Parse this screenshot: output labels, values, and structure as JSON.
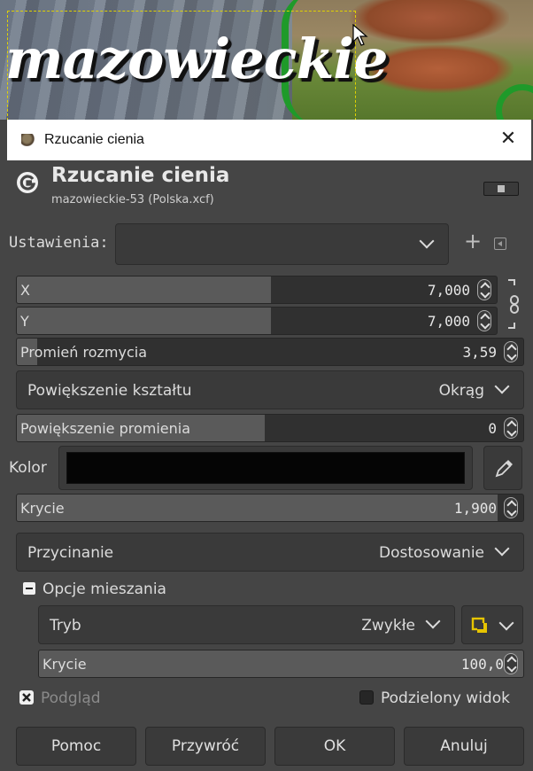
{
  "canvas": {
    "image_title_text": "mazowieckie"
  },
  "window": {
    "title": "Rzucanie cienia",
    "close_glyph": "✕"
  },
  "header": {
    "title": "Rzucanie cienia",
    "subtitle": "mazowieckie-53 (Polska.xcf)"
  },
  "presets": {
    "label": "Ustawienia:",
    "value": "",
    "add_glyph": "+"
  },
  "fields": {
    "x": {
      "label": "X",
      "value": "7,000",
      "fill": 0.53
    },
    "y": {
      "label": "Y",
      "value": "7,000",
      "fill": 0.53
    },
    "blur_radius": {
      "label": "Promień rozmycia",
      "value": "3,59",
      "fill": 0.04
    },
    "grow_shape": {
      "label": "Powiększenie kształtu",
      "value": "Okrąg"
    },
    "grow_radius": {
      "label": "Powiększenie promienia",
      "value": "0",
      "fill": 0.49
    },
    "color": {
      "label": "Kolor",
      "value": "#050505"
    },
    "opacity": {
      "label": "Krycie",
      "value": "1,900",
      "fill": 0.95
    },
    "clipping": {
      "label": "Przycinanie",
      "value": "Dostosowanie"
    }
  },
  "blending": {
    "expander_label": "Opcje mieszania",
    "mode": {
      "label": "Tryb",
      "value": "Zwykłe"
    },
    "opacity": {
      "label": "Krycie",
      "value": "100,0",
      "fill": 1.0
    }
  },
  "preview": {
    "label": "Podgląd",
    "checked": true,
    "split_label": "Podzielony widok",
    "split_checked": false
  },
  "buttons": {
    "help": "Pomoc",
    "reset": "Przywróć",
    "ok": "OK",
    "cancel": "Anuluj"
  },
  "colors": {
    "dialog_bg": "#454545",
    "field_bg": "#303030",
    "fill": "#5a5a5a",
    "accent_yellow": "#e6c400"
  },
  "icons": [
    "gimp-g-icon",
    "close-icon",
    "chevron-down-icon",
    "plus-icon",
    "chain-icon",
    "eyedropper-icon",
    "composite-mode-icon",
    "spin-arrows-icon"
  ]
}
